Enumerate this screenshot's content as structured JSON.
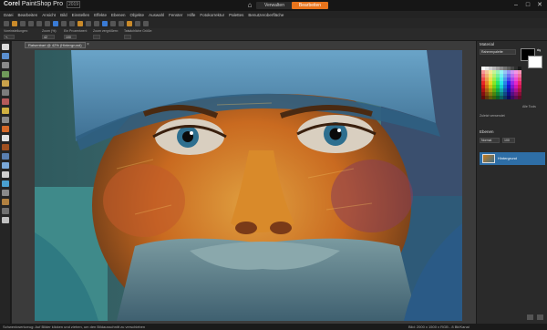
{
  "app": {
    "brand_corel": "Corel",
    "brand_name": "PaintShop Pro",
    "version": "2019"
  },
  "top_tabs": {
    "manage": "Verwalten",
    "edit": "Bearbeiten"
  },
  "window_controls": {
    "minimize": "–",
    "maximize": "□",
    "close": "✕"
  },
  "menu": [
    "Datei",
    "Bearbeiten",
    "Ansicht",
    "Bild",
    "Einstellen",
    "Effekte",
    "Ebenen",
    "Objekte",
    "Auswahl",
    "Fenster",
    "Hilfe",
    "Fotokorrektur",
    "Palettes",
    "Benutzeroberfläche"
  ],
  "tool_options": {
    "labels": [
      "Voreinstellungen:",
      "Zoom (%):",
      "Ein Prozentwert:",
      "Zoom vergrößern:",
      "Tatsächliche Größe:"
    ],
    "values": [
      "↖",
      "42",
      "100"
    ]
  },
  "document": {
    "tab_label": "Ratsenbart @ 42% (Hintergrund)",
    "close": "×"
  },
  "material_panel": {
    "title": "Material",
    "dropdown": "Rahmenpalette",
    "recent": "Zuletzt verwendet",
    "all_tools": "Alle Tools"
  },
  "layers_panel": {
    "title": "Ebenen",
    "blend": "Normal",
    "opacity": "100",
    "layer_name": "Hintergrund"
  },
  "status": {
    "left": "Schwenkwerkzeug: Auf Bilder klicken und ziehen, um den Bildausschnitt zu verschieben",
    "right": "Bild: 2000 x 1500 x RGB - 8 Bit/Kanal"
  },
  "colors": {
    "accent": "#e8741c",
    "selected_layer": "#2e6ea6",
    "foreground": "#000000",
    "background": "#ffffff"
  },
  "icons": [
    "home-icon",
    "pan-icon",
    "zoom-icon",
    "crop-icon",
    "brush-icon",
    "eraser-icon",
    "text-icon",
    "swap-colors-icon",
    "add-layer-icon",
    "delete-layer-icon"
  ]
}
